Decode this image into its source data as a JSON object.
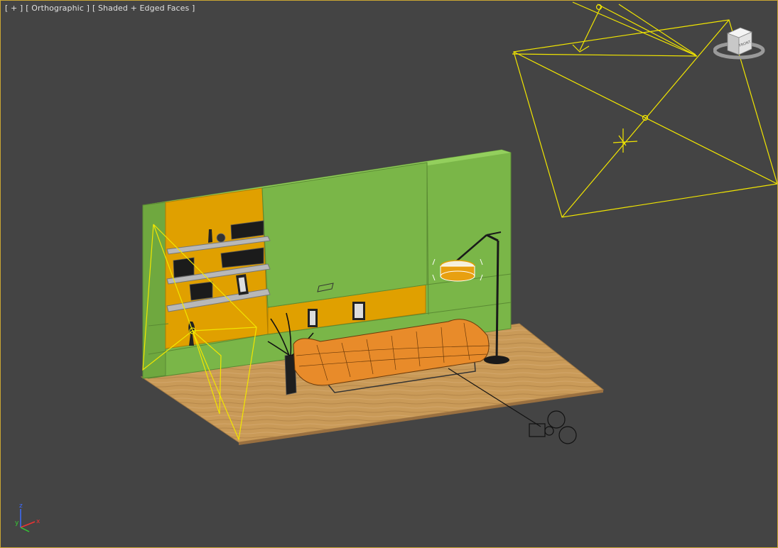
{
  "viewport": {
    "label_plus": "[ + ]",
    "label_view": "[ Orthographic ]",
    "label_shading": "[ Shaded + Edged Faces ]"
  },
  "viewcube": {
    "face_label": "FRONT"
  },
  "axis_tripod": {
    "x": "x",
    "y": "y",
    "z": "z"
  },
  "colors": {
    "viewport_bg": "#444444",
    "viewport_border": "#c9a633",
    "wall_green": "#7ab648",
    "panel_orange": "#e0a000",
    "floor_wood": "#c89a5b",
    "sofa_orange": "#e88b2a",
    "selection_yellow": "#f2e600"
  },
  "scene_objects": [
    "wall",
    "shelves",
    "books",
    "vases",
    "picture-frames",
    "sofa",
    "floor-lamp",
    "floor",
    "camera",
    "spotlight",
    "directional-light"
  ]
}
